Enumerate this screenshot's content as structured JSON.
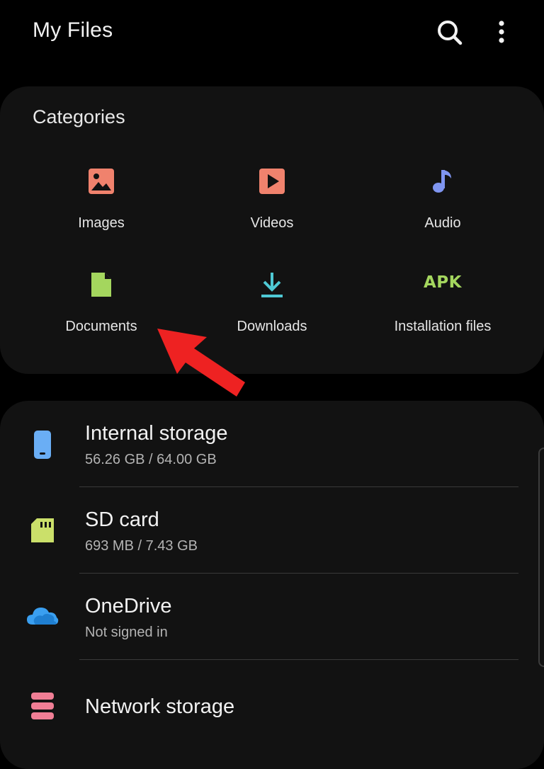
{
  "app_bar": {
    "title": "My Files",
    "search_icon": "search-icon",
    "more_icon": "more-vertical-icon"
  },
  "categories": {
    "title": "Categories",
    "items": [
      {
        "label": "Images",
        "icon": "image-icon",
        "color": "#f0826d"
      },
      {
        "label": "Videos",
        "icon": "video-play-icon",
        "color": "#f0826d"
      },
      {
        "label": "Audio",
        "icon": "music-note-icon",
        "color": "#7f95f0"
      },
      {
        "label": "Documents",
        "icon": "document-icon",
        "color": "#a4d65e"
      },
      {
        "label": "Downloads",
        "icon": "download-icon",
        "color": "#4fc9d4"
      },
      {
        "label": "Installation files",
        "icon": "apk-icon",
        "icon_text": "APK",
        "color": "#a4d65e"
      }
    ]
  },
  "storage": {
    "items": [
      {
        "name": "Internal storage",
        "detail": "56.26 GB / 64.00 GB",
        "icon": "phone-icon",
        "color": "#6aaef5"
      },
      {
        "name": "SD card",
        "detail": "693 MB / 7.43 GB",
        "icon": "sd-card-icon",
        "color": "#cbe06a"
      },
      {
        "name": "OneDrive",
        "detail": "Not signed in",
        "icon": "cloud-icon",
        "color": "#3a9ff0"
      },
      {
        "name": "Network storage",
        "detail": "",
        "icon": "server-icon",
        "color": "#f07e95"
      }
    ]
  },
  "annotation": {
    "arrow_color": "#ee2222",
    "arrow_icon": "red-pointer-arrow"
  }
}
